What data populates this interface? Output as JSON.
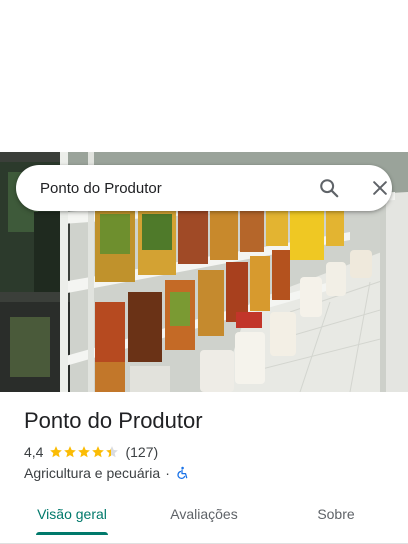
{
  "search": {
    "query": "Ponto do Produtor",
    "search_icon": "search-icon",
    "close_icon": "close-icon"
  },
  "photo": {
    "description_icon": "store-shelves-photo"
  },
  "place": {
    "title": "Ponto do Produtor",
    "rating": "4,4",
    "stars": 4.4,
    "review_count": "(127)",
    "category": "Agricultura e pecuária",
    "separator": "·",
    "accessibility_icon": "wheelchair-icon"
  },
  "tabs": [
    {
      "label": "Visão geral",
      "active": true
    },
    {
      "label": "Avaliações",
      "active": false
    },
    {
      "label": "Sobre",
      "active": false
    }
  ],
  "colors": {
    "accent": "#00796b",
    "star": "#fbbc04",
    "accessibility": "#1a73e8",
    "text": "#202124",
    "secondary_text": "#3c4043"
  }
}
